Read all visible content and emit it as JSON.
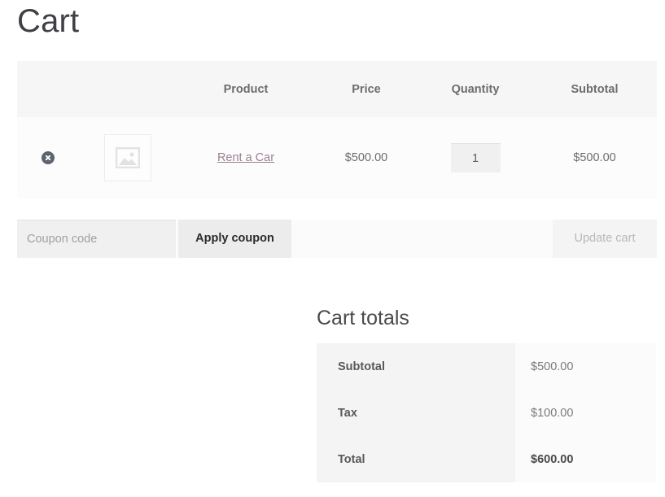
{
  "page": {
    "title": "Cart"
  },
  "cart_table": {
    "columns": [
      "",
      "",
      "Product",
      "Price",
      "Quantity",
      "Subtotal"
    ],
    "headers": {
      "product": "Product",
      "price": "Price",
      "quantity": "Quantity",
      "subtotal": "Subtotal"
    },
    "rows": [
      {
        "remove_icon": "remove-circle-x-icon",
        "thumbnail_icon": "image-placeholder-icon",
        "product_name": "Rent a Car",
        "price": "$500.00",
        "quantity": "1",
        "subtotal": "$500.00"
      }
    ]
  },
  "actions": {
    "coupon_value": "",
    "coupon_placeholder": "Coupon code",
    "apply_coupon_label": "Apply coupon",
    "update_cart_label": "Update cart"
  },
  "cart_totals": {
    "heading": "Cart totals",
    "rows": [
      {
        "label": "Subtotal",
        "value": "$500.00"
      },
      {
        "label": "Tax",
        "value": "$100.00"
      },
      {
        "label": "Total",
        "value": "$600.00"
      }
    ]
  },
  "colors": {
    "link": "#9c7f93",
    "remove_button": "#5d6470",
    "header_band": "#f6f6f6",
    "row_background": "#fcfcfc",
    "button_background": "#ececec",
    "totals_label_cell": "#f4f4f4",
    "totals_value_cell": "#fbfbfb"
  }
}
